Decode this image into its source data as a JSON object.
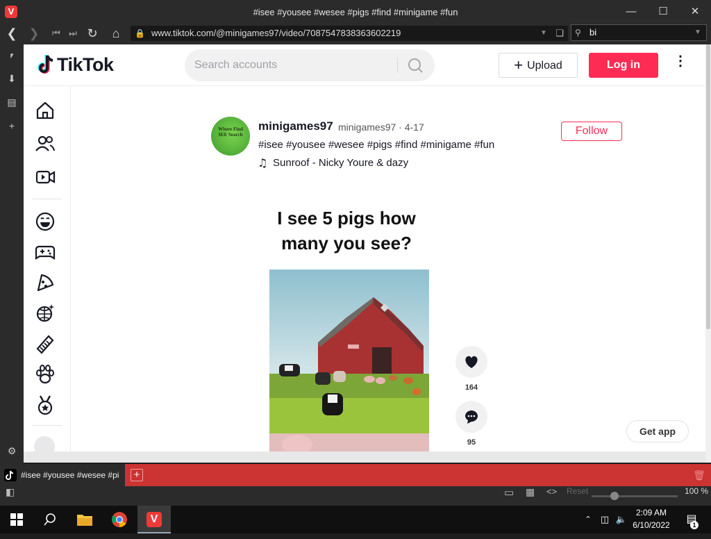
{
  "window": {
    "title": "#isee #yousee #wesee #pigs #find #minigame #fun",
    "minimize_icon": "minimize-icon",
    "maximize_icon": "maximize-icon",
    "close_icon": "close-icon",
    "brand_color": "#ef3939"
  },
  "address_bar": {
    "url": "www.tiktok.com/@minigames97/video/7087547838363602219",
    "search_value": "bi"
  },
  "tiktok": {
    "logo_text": "TikTok",
    "search_placeholder": "Search accounts",
    "upload_label": "Upload",
    "login_label": "Log in",
    "login_color": "#fe2c55",
    "sidebar_icons": [
      "home-icon",
      "following-icon",
      "live-icon",
      "comedy-icon",
      "gaming-icon",
      "food-icon",
      "dance-icon",
      "beauty-icon",
      "animals-icon",
      "sports-icon"
    ]
  },
  "post": {
    "avatar_text": "Where Find $EE Search",
    "author_name": "minigames97",
    "author_meta": "minigames97 · 4-17",
    "caption": "#isee #yousee #wesee #pigs #find #minigame #fun",
    "music": "Sunroof - Nicky Youre & dazy",
    "follow_label": "Follow",
    "video_title": "I see 5 pigs how many you see?",
    "likes": "164",
    "comments": "95"
  },
  "get_app_label": "Get app",
  "tabs": {
    "active_title": "#isee #yousee #wesee #pigs #find #minigame #fun"
  },
  "status_bar": {
    "reset_label": "Reset",
    "zoom_percent": "100 %",
    "zoom_level": 1.0
  },
  "taskbar": {
    "time": "2:09 AM",
    "date": "6/10/2022",
    "notification_count": "1"
  }
}
